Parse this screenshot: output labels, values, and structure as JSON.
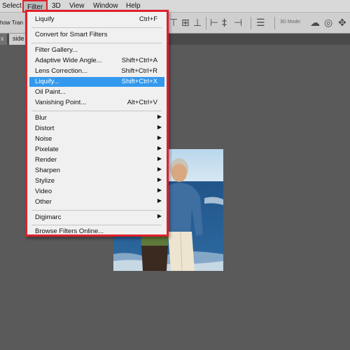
{
  "menubar": {
    "items": [
      "Select",
      "Filter",
      "3D",
      "View",
      "Window",
      "Help"
    ]
  },
  "optionsbar": {
    "label": "how Tran",
    "mode_label": "3D Mode:"
  },
  "tabbar": {
    "close_glyph": "x",
    "document_tab": "side"
  },
  "filter_menu": {
    "last_filter": {
      "label": "Liquify",
      "shortcut": "Ctrl+F"
    },
    "convert": {
      "label": "Convert for Smart Filters"
    },
    "items": [
      {
        "label": "Filter Gallery...",
        "shortcut": ""
      },
      {
        "label": "Adaptive Wide Angle...",
        "shortcut": "Shift+Ctrl+A"
      },
      {
        "label": "Lens Correction...",
        "shortcut": "Shift+Ctrl+R"
      },
      {
        "label": "Liquify...",
        "shortcut": "Shift+Ctrl+X",
        "highlighted": true
      },
      {
        "label": "Oil Paint...",
        "shortcut": ""
      },
      {
        "label": "Vanishing Point...",
        "shortcut": "Alt+Ctrl+V"
      }
    ],
    "submenus": [
      "Blur",
      "Distort",
      "Noise",
      "Pixelate",
      "Render",
      "Sharpen",
      "Stylize",
      "Video",
      "Other"
    ],
    "digimarc": {
      "label": "Digimarc"
    },
    "browse": {
      "label": "Browse Filters Online..."
    },
    "highlight_color": "#3399ee",
    "annotation_color": "#e0202a"
  }
}
